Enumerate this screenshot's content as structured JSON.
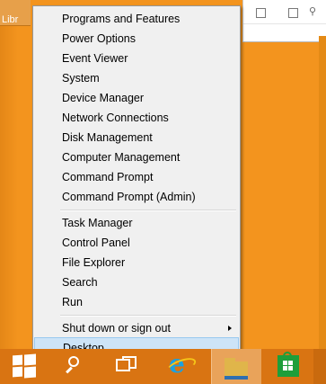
{
  "desktop": {
    "icon_label": "Libr"
  },
  "context_menu": {
    "groups": [
      [
        "Programs and Features",
        "Power Options",
        "Event Viewer",
        "System",
        "Device Manager",
        "Network Connections",
        "Disk Management",
        "Computer Management",
        "Command Prompt",
        "Command Prompt (Admin)"
      ],
      [
        "Task Manager",
        "Control Panel",
        "File Explorer",
        "Search",
        "Run"
      ]
    ],
    "shutdown_label": "Shut down or sign out",
    "desktop_label": "Desktop",
    "highlighted_item": "Desktop"
  },
  "taskbar": {
    "icons": [
      "windows-start-icon",
      "search-icon",
      "task-view-icon",
      "internet-explorer-icon",
      "file-explorer-icon",
      "store-icon"
    ]
  },
  "colors": {
    "desktop_background": "#f3941e",
    "taskbar": "#d97412",
    "menu_background": "#f0f0f0",
    "menu_highlight": "#cde4f7"
  }
}
